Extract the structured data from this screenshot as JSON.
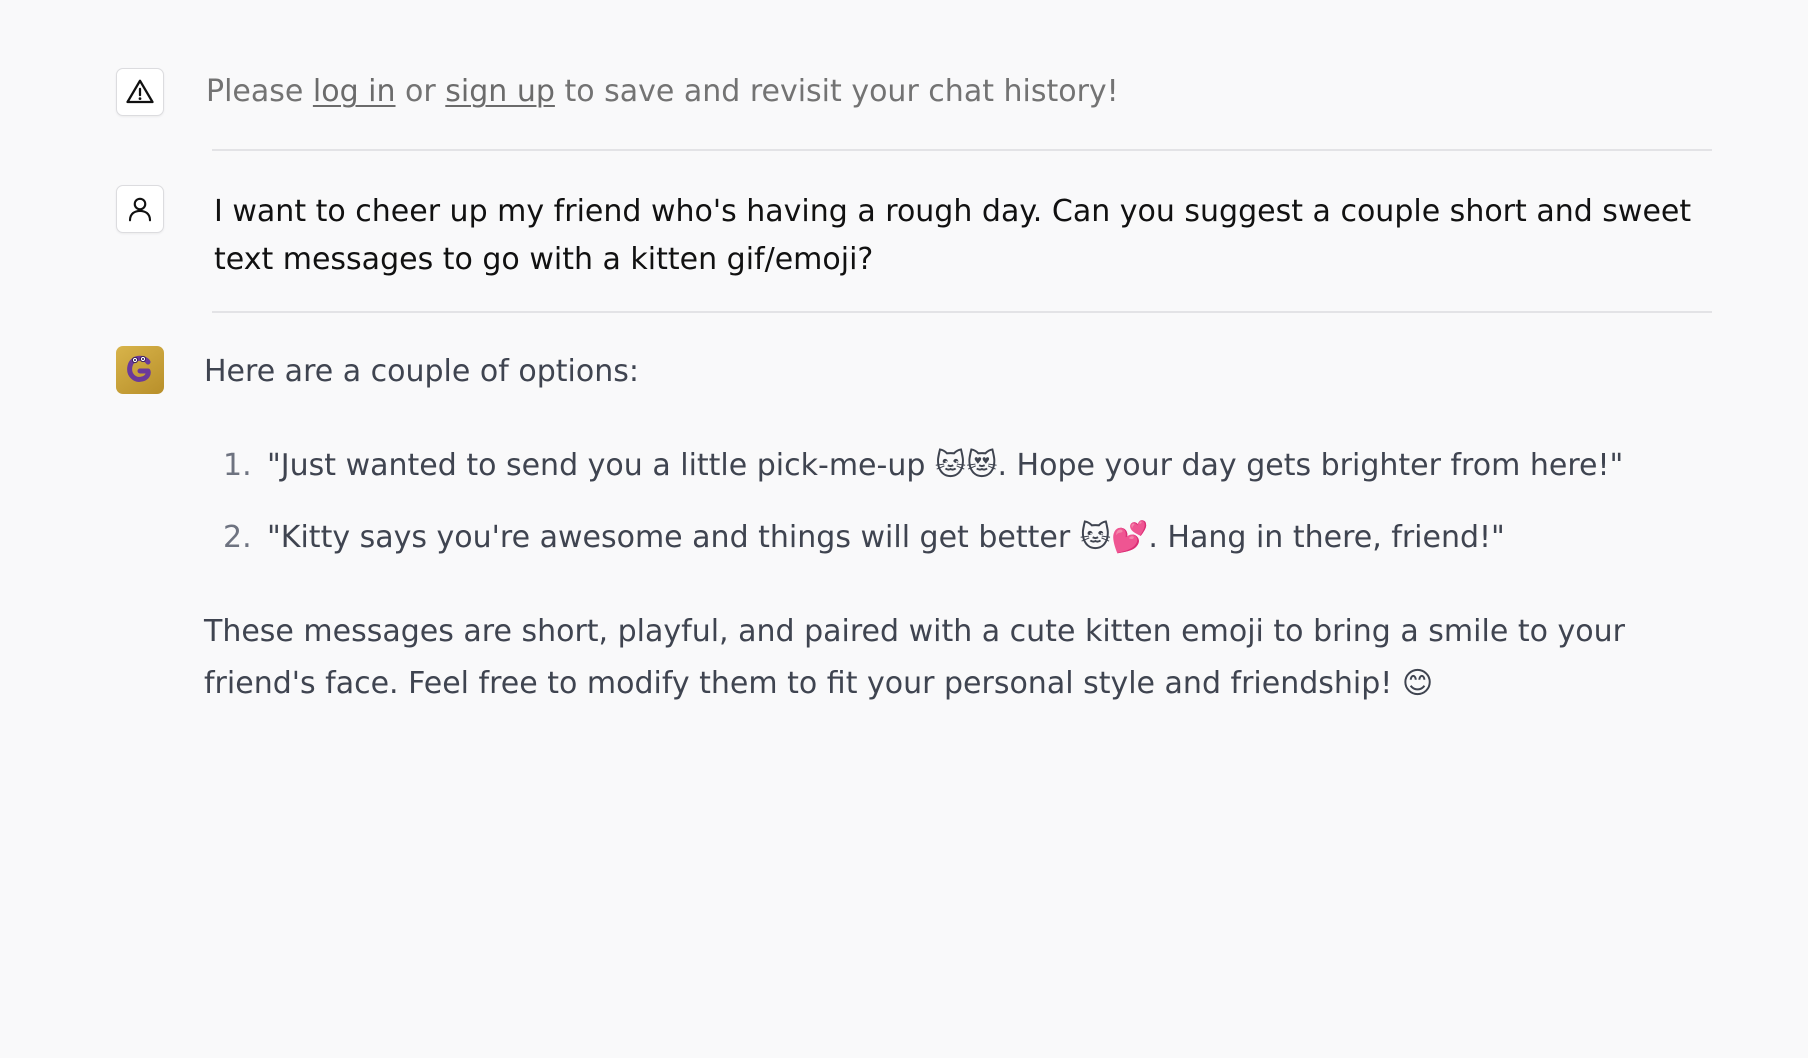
{
  "notice": {
    "prefix": "Please ",
    "login_link": "log in",
    "middle": " or ",
    "signup_link": "sign up",
    "suffix": " to save and revisit your chat history!"
  },
  "user_message": {
    "text": "I want to cheer up my friend who's having a rough day. Can you suggest a couple short and sweet text messages to go with a kitten gif/emoji?"
  },
  "bot_message": {
    "intro": "Here are a couple of options:",
    "options": [
      {
        "number": "1.",
        "text": "\"Just wanted to send you a little pick-me-up 🐱😻. Hope your day gets brighter from here!\""
      },
      {
        "number": "2.",
        "text": "\"Kitty says you're awesome and things will get better 🐱💕. Hang in there, friend!\""
      }
    ],
    "outro": "These messages are short, playful, and paired with a cute kitten emoji to bring a smile to your friend's face. Feel free to modify them to fit your personal style and friendship! 😊"
  },
  "icons": {
    "notice": "warning-triangle-icon",
    "user": "user-icon",
    "bot": "bot-avatar"
  },
  "colors": {
    "background": "#f9f9fa",
    "bot_avatar": "#c9a23a",
    "bot_avatar_glyph": "#6a3a9a"
  }
}
